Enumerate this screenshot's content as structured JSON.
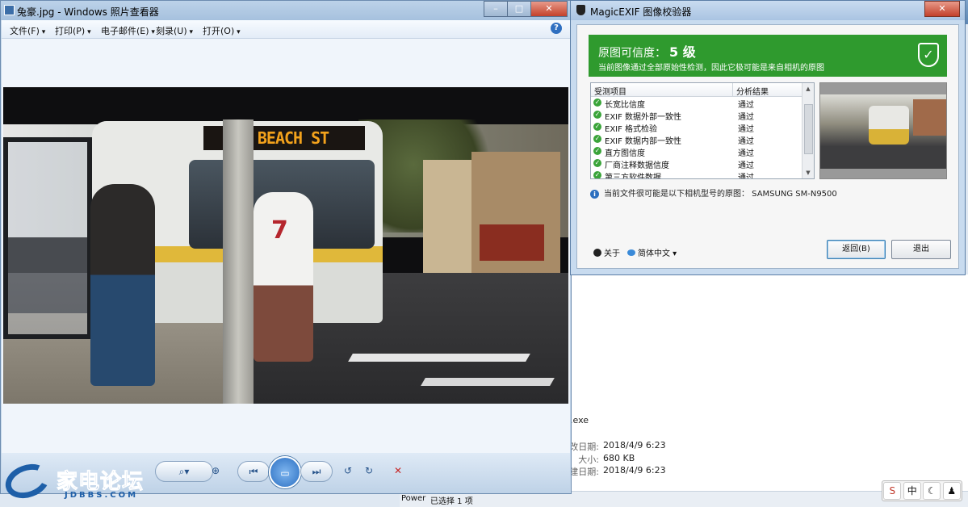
{
  "photo_viewer": {
    "title": "兔豪.jpg - Windows 照片查看器",
    "window_buttons": [
      "–",
      "□",
      "✕"
    ],
    "menu": [
      "文件(F)",
      "打印(P)",
      "电子邮件(E)",
      "刻录(U)",
      "打开(O)"
    ],
    "help_icon": "?",
    "photo_sign_text": "A BEACH ST",
    "toolbar": {
      "zoom": "⌕▾",
      "fit": "⊕",
      "prev": "⏮",
      "slideshow": "▭",
      "next": "⏭",
      "rotate_left": "↺",
      "rotate_right": "↻",
      "delete": "✕"
    }
  },
  "watermark": {
    "brand": "家电论坛",
    "url": "JDBBS.COM"
  },
  "explorer": {
    "file_suffix": ".exe",
    "details": [
      {
        "label": "改日期:",
        "value": "2018/4/9 6:23"
      },
      {
        "label": "大小:",
        "value": "680 KB"
      },
      {
        "label": "建日期:",
        "value": "2018/4/9 6:23"
      }
    ],
    "status": "已选择 1 项",
    "status_left": "Power",
    "ime": [
      "S",
      "中",
      "☾",
      "♟"
    ]
  },
  "magicexif": {
    "title": "MagicEXIF 图像校验器",
    "close": "✕",
    "banner": {
      "label": "原图可信度：",
      "level": "5 级",
      "description": "当前图像通过全部原始性检测，因此它极可能是来自相机的原图",
      "icon": "shield-check-icon"
    },
    "table": {
      "headers": [
        "受测项目",
        "分析结果"
      ],
      "rows": [
        {
          "name": "长宽比信度",
          "result": "通过"
        },
        {
          "name": "EXIF 数据外部一致性",
          "result": "通过"
        },
        {
          "name": "EXIF 格式检验",
          "result": "通过"
        },
        {
          "name": "EXIF 数据内部一致性",
          "result": "通过"
        },
        {
          "name": "直方图信度",
          "result": "通过"
        },
        {
          "name": "厂商注释数据信度",
          "result": "通过"
        },
        {
          "name": "第三方软件数据",
          "result": "通过"
        }
      ]
    },
    "camera_info": "当前文件很可能是以下相机型号的原图： SAMSUNG SM-N9500",
    "about": "关于",
    "language": "简体中文",
    "back_button": "返回(B)",
    "exit_button": "退出"
  },
  "colors": {
    "banner_green": "#2f9a2e",
    "pass_green": "#3aa43a",
    "window_blue": "#a6c1de"
  }
}
